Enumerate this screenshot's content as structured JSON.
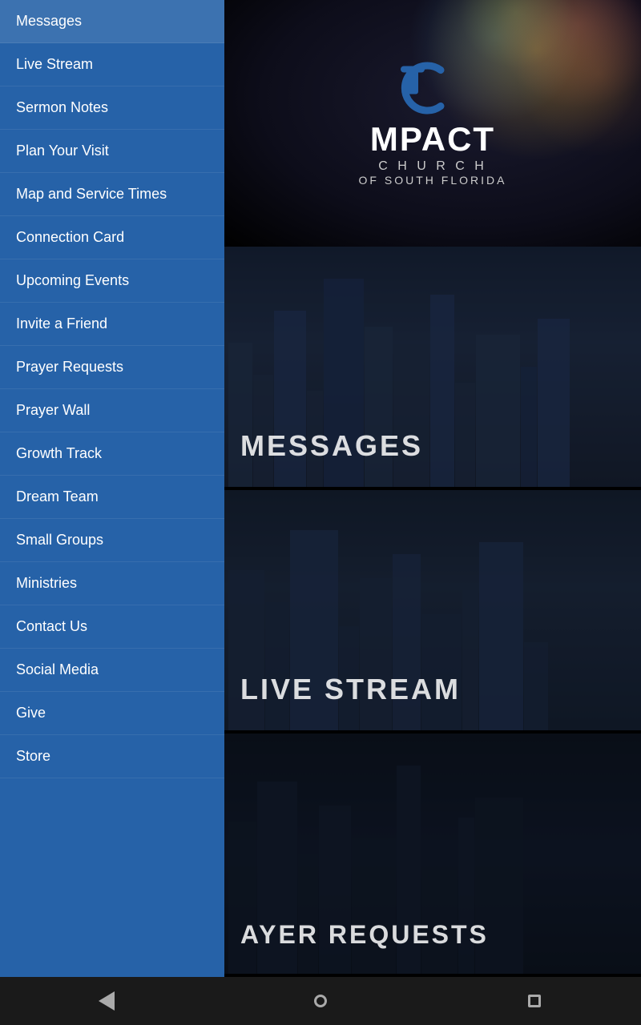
{
  "sidebar": {
    "items": [
      {
        "id": "messages",
        "label": "Messages"
      },
      {
        "id": "live-stream",
        "label": "Live Stream"
      },
      {
        "id": "sermon-notes",
        "label": "Sermon Notes"
      },
      {
        "id": "plan-your-visit",
        "label": "Plan Your Visit"
      },
      {
        "id": "map-service-times",
        "label": "Map and Service Times"
      },
      {
        "id": "connection-card",
        "label": "Connection Card"
      },
      {
        "id": "upcoming-events",
        "label": "Upcoming Events"
      },
      {
        "id": "invite-friend",
        "label": "Invite a Friend"
      },
      {
        "id": "prayer-requests",
        "label": "Prayer Requests"
      },
      {
        "id": "prayer-wall",
        "label": "Prayer Wall"
      },
      {
        "id": "growth-track",
        "label": "Growth Track"
      },
      {
        "id": "dream-team",
        "label": "Dream Team"
      },
      {
        "id": "small-groups",
        "label": "Small Groups"
      },
      {
        "id": "ministries",
        "label": "Ministries"
      },
      {
        "id": "contact-us",
        "label": "Contact Us"
      },
      {
        "id": "social-media",
        "label": "Social Media"
      },
      {
        "id": "give",
        "label": "Give"
      },
      {
        "id": "store",
        "label": "Store"
      }
    ]
  },
  "hero": {
    "church_name": "MPACT",
    "church_line1": "C H U R C H",
    "church_line2": "OF SOUTH FLORIDA"
  },
  "tiles": [
    {
      "id": "messages-tile",
      "label": "MESSAGES"
    },
    {
      "id": "live-stream-tile",
      "label": "LIVE STREAM"
    },
    {
      "id": "prayer-requests-tile",
      "label": "AYER REQUESTS"
    }
  ],
  "android_nav": {
    "back": "◄",
    "home": "●",
    "recent": "■"
  }
}
